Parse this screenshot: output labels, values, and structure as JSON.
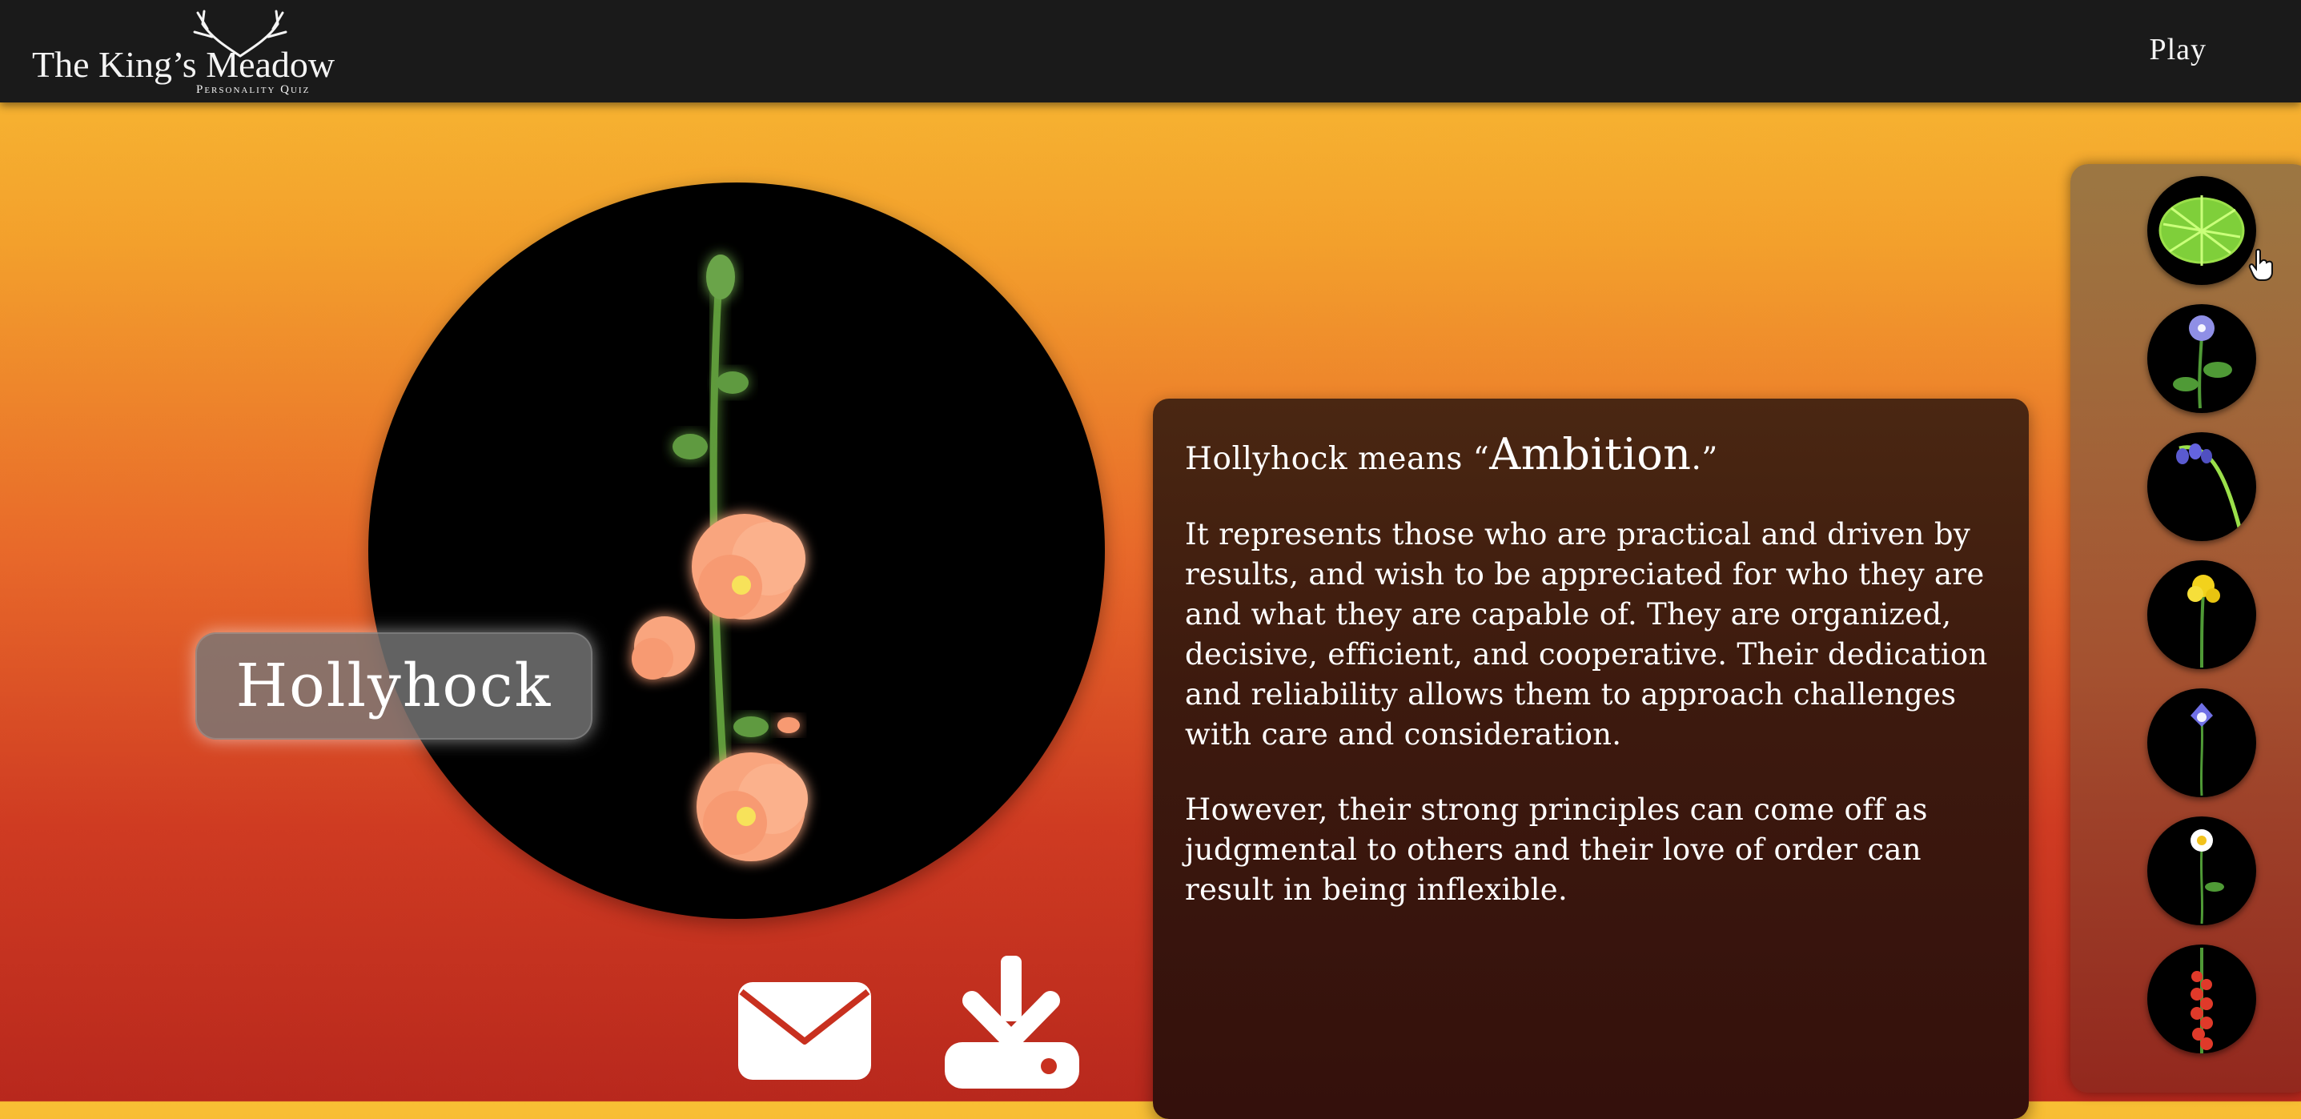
{
  "header": {
    "logo_title": "The King’s Meadow",
    "logo_subtitle": "Personality Quiz",
    "play_label": "Play"
  },
  "result": {
    "flower_name": "Hollyhock",
    "heading_prefix": "Hollyhock means “",
    "heading_word": "Ambition",
    "heading_suffix": ".”",
    "paragraphs": [
      "It represents those who are practical and driven by results, and wish to be appreciated for who they are and what they are capable of. They are organized, decisive, efficient, and cooperative. Their dedication and reliability allows them to approach challenges with care and consideration.",
      "However, their strong principles can come off as judgmental to others and their love of order can result in being inflexible."
    ]
  },
  "actions": {
    "email_icon": "envelope-icon",
    "download_icon": "download-icon"
  },
  "sidebar": {
    "thumbnails": [
      {
        "icon": "fern-icon"
      },
      {
        "icon": "violet-icon"
      },
      {
        "icon": "bluebell-icon"
      },
      {
        "icon": "yellow-flower-icon"
      },
      {
        "icon": "columbine-icon"
      },
      {
        "icon": "daisy-icon"
      },
      {
        "icon": "red-spike-flower-icon"
      }
    ]
  },
  "colors": {
    "topbar": "#1a1a1a",
    "gradient_top": "#f8bf34",
    "gradient_bottom": "#b8281d",
    "petal": "#f9a57e",
    "stem": "#5f9b3a"
  }
}
